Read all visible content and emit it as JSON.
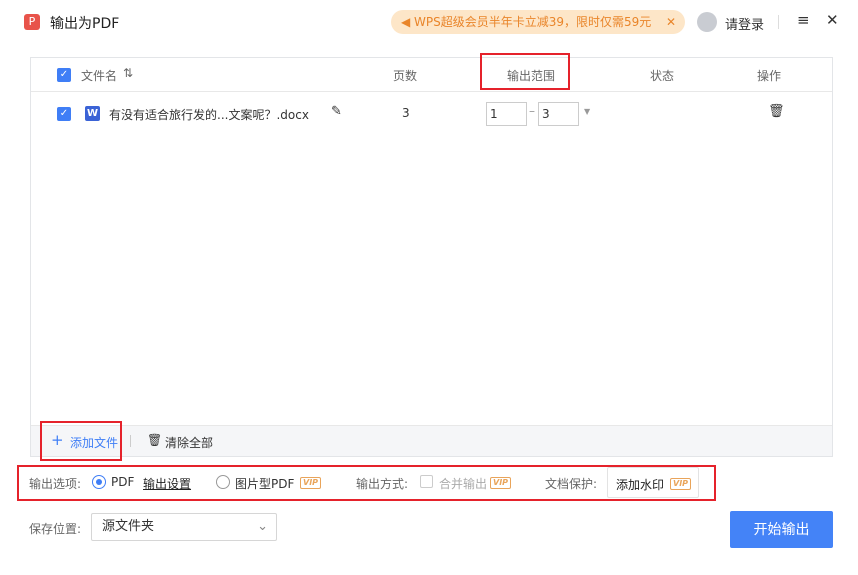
{
  "window": {
    "title": "输出为PDF",
    "logo": "P",
    "promo": "WPS超级会员半年卡立减39，限时仅需59元",
    "login": "请登录",
    "menu_icon": "≡",
    "close_icon": "✕"
  },
  "table": {
    "headers": {
      "filename": "文件名",
      "pages": "页数",
      "range": "输出范围",
      "status": "状态",
      "actions": "操作"
    },
    "rows": [
      {
        "filename": "有没有适合旅行发的...文案呢？.docx",
        "pages": "3",
        "range_from": "1",
        "range_to": "3",
        "status": ""
      }
    ]
  },
  "footer": {
    "add_file": "添加文件",
    "clear_all": "清除全部"
  },
  "options": {
    "label": "输出选项:",
    "pdf": "PDF",
    "settings": "输出设置",
    "image_pdf": "图片型PDF",
    "vip": "VIP",
    "method_label": "输出方式:",
    "merge": "合并输出",
    "protect_label": "文档保护:",
    "watermark": "添加水印"
  },
  "save": {
    "label": "保存位置:",
    "value": "源文件夹"
  },
  "start_button": "开始输出",
  "colors": {
    "accent": "#3f7ef6",
    "highlight": "#e5222b",
    "promo": "#e9852a"
  }
}
